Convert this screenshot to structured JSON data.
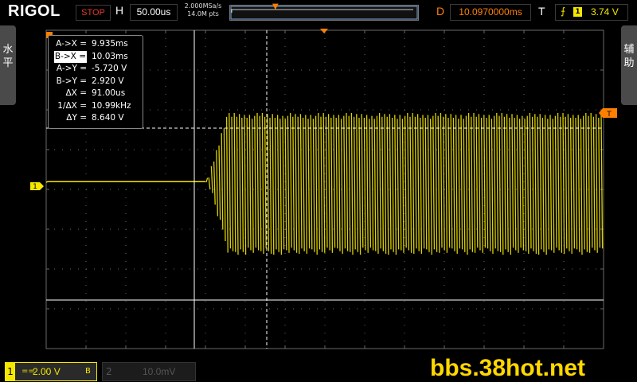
{
  "header": {
    "brand": "RIGOL",
    "run_state": "STOP",
    "horizontal_label": "H",
    "timebase": "50.00us",
    "sample_rate": "2.000MSa/s",
    "memory_depth": "14.0M pts",
    "delay_label": "D",
    "delay": "10.0970000ms",
    "trigger_label": "T",
    "trigger_source": "1",
    "trigger_level": "3.74 V"
  },
  "side_tabs": {
    "left": "水\n平",
    "right": "辅\n助"
  },
  "cursor_panel": {
    "rows": [
      {
        "label": "A->X =",
        "value": "9.935ms",
        "selected": false
      },
      {
        "label": "B->X =",
        "value": "10.03ms",
        "selected": true
      },
      {
        "label": "A->Y =",
        "value": "-5.720 V",
        "selected": false
      },
      {
        "label": "B->Y =",
        "value": "2.920 V",
        "selected": false
      },
      {
        "label": "ΔX =",
        "value": "91.00us",
        "selected": false
      },
      {
        "label": "1/ΔX =",
        "value": "10.99kHz",
        "selected": false
      },
      {
        "label": "ΔY =",
        "value": "8.640 V",
        "selected": false
      }
    ]
  },
  "markers": {
    "ch1_ground": "1",
    "trigger_level": "T"
  },
  "channels": {
    "ch1": {
      "number": "1",
      "coupling": "==",
      "scale": "2.00 V",
      "bw": "B"
    },
    "ch2": {
      "number": "2",
      "scale": "10.0mV"
    }
  },
  "watermark": "bbs.38hot.net",
  "colors": {
    "ch1": "#f5e800",
    "trigger": "#ff7f00",
    "grid": "#6a6a6a",
    "run_state": "#e23a2a"
  },
  "icons": {
    "trigger_edge": "rising-edge-icon",
    "trigger_marker": "trigger-position-icon"
  }
}
